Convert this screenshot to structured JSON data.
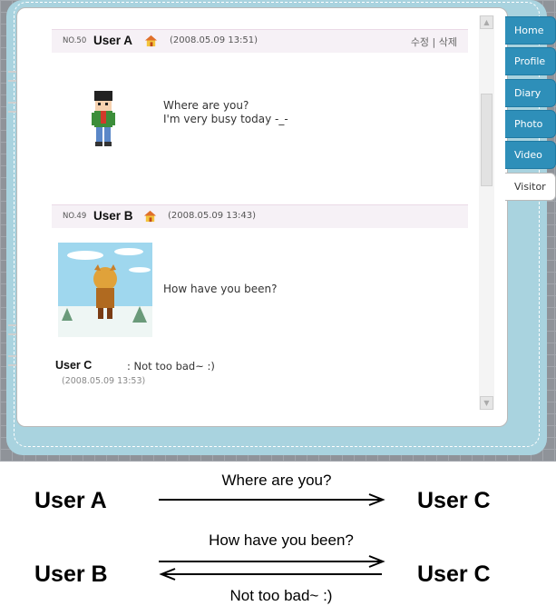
{
  "nav_tabs": [
    "Home",
    "Profile",
    "Diary",
    "Photo",
    "Video",
    "Visitor"
  ],
  "posts": [
    {
      "no": "NO.50",
      "user": "User A",
      "date": "(2008.05.09 13:51)",
      "actions": "수정 | 삭제",
      "message": "Where are you?\nI'm very busy today -_-"
    },
    {
      "no": "NO.49",
      "user": "User B",
      "date": "(2008.05.09 13:43)",
      "message": "How have you been?",
      "reply": {
        "user": "User C",
        "text": " : Not too bad~ :)",
        "date": "(2008.05.09 13:53)"
      }
    }
  ],
  "diagram": {
    "row1": {
      "from": "User A",
      "to": "User C",
      "label": "Where are you?"
    },
    "row2": {
      "from": "User B",
      "to": "User C",
      "label_top": "How have you been?",
      "label_bottom": "Not too bad~ :)"
    }
  },
  "icons": [
    "home-icon",
    "scroll-up-arrow-icon",
    "scroll-down-arrow-icon"
  ],
  "colors": {
    "tab_blue": "#2e8fb9",
    "frame_blue": "#a9d3df",
    "header_pink": "#f6f1f6"
  }
}
